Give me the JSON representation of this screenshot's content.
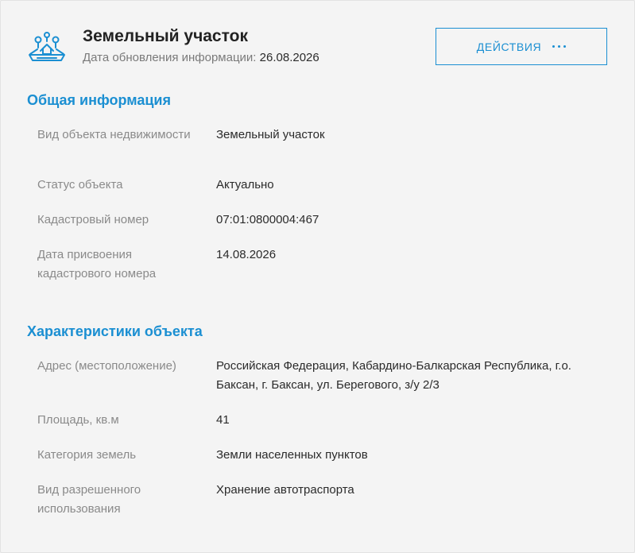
{
  "header": {
    "title": "Земельный участок",
    "updated_label": "Дата обновления информации:",
    "updated_date": "26.08.2026",
    "actions_label": "ДЕЙСТВИЯ",
    "icon": "land-plot-icon",
    "actions_icon": "more-dots-icon"
  },
  "general": {
    "title": "Общая информация",
    "rows": [
      {
        "label": "Вид объекта недвижимости",
        "value": "Земельный участок"
      },
      {
        "label": "Статус объекта",
        "value": "Актуально"
      },
      {
        "label": "Кадастровый номер",
        "value": "07:01:0800004:467"
      },
      {
        "label": "Дата присвоения кадастрового номера",
        "value": "14.08.2026"
      }
    ]
  },
  "characteristics": {
    "title": "Характеристики объекта",
    "rows": [
      {
        "label": "Адрес (местоположение)",
        "value": "Российская Федерация, Кабардино-Балкарская Республика, г.о. Баксан, г. Баксан, ул. Берегового, з/у 2/3"
      },
      {
        "label": "Площадь, кв.м",
        "value": "41"
      },
      {
        "label": "Категория земель",
        "value": "Земли населенных пунктов"
      },
      {
        "label": "Вид разрешенного использования",
        "value": "Хранение автотраспорта"
      }
    ]
  },
  "colors": {
    "accent": "#1b8fd2",
    "label": "#8a8a8a",
    "text": "#2b2b2b",
    "background": "#f4f4f4"
  }
}
